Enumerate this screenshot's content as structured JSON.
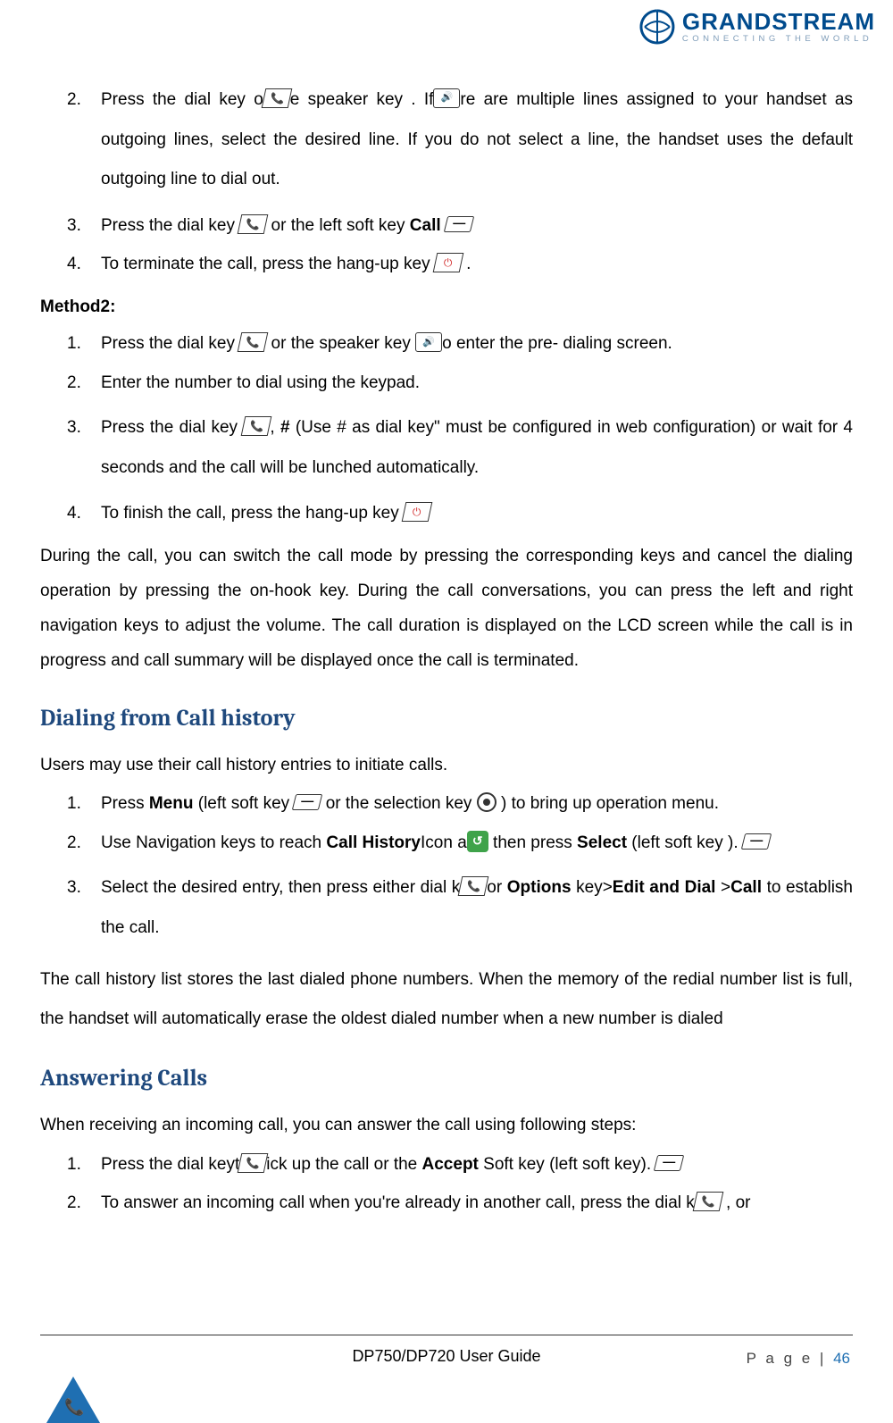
{
  "logo": {
    "brand": "GRANDSTREAM",
    "tagline": "CONNECTING THE WORLD"
  },
  "method1": {
    "items": [
      {
        "num": "2.",
        "pre": "Press the dial key o",
        "mid": "e speaker key       . If",
        "post": "re are multiple lines assigned to your handset as outgoing lines, select the desired line. If you do not select a line, the handset uses the default outgoing line to dial out."
      },
      {
        "num": "3.",
        "pre": "Press the dial key ",
        "mid": " or the left soft key ",
        "b": "Call",
        "post": "  "
      },
      {
        "num": "4.",
        "pre": "To terminate the call, press the hang-up key",
        "post": " ."
      }
    ]
  },
  "method2": {
    "label": "Method2:",
    "items": [
      {
        "num": "1.",
        "pre": "Press the dial key  ",
        "mid": "or the speaker key    ",
        "post": "o enter the pre- dialing screen."
      },
      {
        "num": "2.",
        "text": "Enter the number to dial using the keypad."
      },
      {
        "num": "3.",
        "pre": "Press the dial key  ",
        "mid": ", ",
        "hash": "#",
        "post1": " (Use # as dial key\" must be configured in web configuration) or wait for 4 seconds and the call will be lunched automatically."
      },
      {
        "num": "4.",
        "pre": "To finish the call, press the hang-up key "
      }
    ]
  },
  "during_para": "During the call, you can switch the call mode by pressing the corresponding keys and cancel the dialing operation by pressing the on-hook key. During the call conversations, you can press the left and right navigation keys to adjust the volume. The call duration is displayed on the LCD screen while the call is in progress and call summary will be displayed once the call is terminated.",
  "section_dial_history": {
    "title": "Dialing from Call history",
    "intro": "Users may use their call history entries to initiate calls.",
    "items": [
      {
        "num": "1.",
        "pre": "Press ",
        "b1": "Menu",
        "mid1": " (left soft key ",
        "mid2": " or the selection key",
        "post": " ) to bring up operation menu."
      },
      {
        "num": "2.",
        "pre": "Use Navigation keys to reach ",
        "b1": "Call History",
        "mid1": "Icon a",
        "mid2": "then press ",
        "b2": "Select",
        "mid3": " (left soft key        ).  "
      },
      {
        "num": "3.",
        "pre": "Select  the  desired  entry,  then  press  either  dial  k",
        "mid1": "or  ",
        "b1": "Options",
        "mid2": "  key>",
        "b2": "Edit  and  Dial",
        "mid3": "  >",
        "b3": "Call",
        "post": "  to establish the call."
      }
    ],
    "outro": "The call history list stores the last dialed phone numbers. When the memory of the redial number list is full, the handset will automatically erase the oldest dialed number when a new number is dialed"
  },
  "section_answering": {
    "title": "Answering Calls",
    "intro": "When receiving an incoming call, you can answer the call using following steps:",
    "items": [
      {
        "num": "1.",
        "pre": "Press the dial keyt",
        "mid": "ick up the call or the ",
        "b": "Accept",
        "post": " Soft key (left soft key).          "
      },
      {
        "num": "2.",
        "pre": "To  answer  an  incoming  call  when  you're  already  in  another  call,  press  the  dial  k",
        "post": "     ,  or"
      }
    ]
  },
  "footer": {
    "doc": "DP750/DP720 User Guide",
    "page_label": "P a g e | ",
    "page_num": "46"
  }
}
